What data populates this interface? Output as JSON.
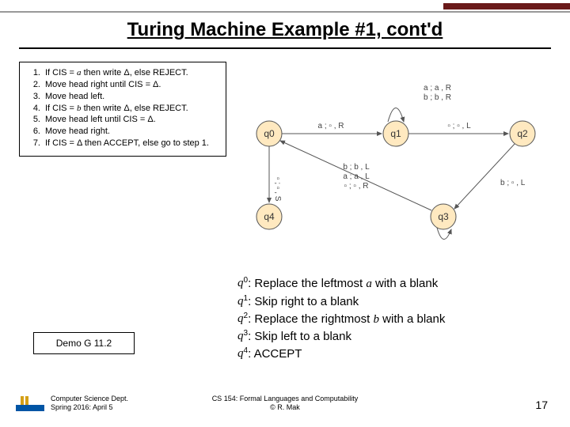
{
  "title": "Turing Machine Example #1, cont'd",
  "algorithm": [
    {
      "n": "1.",
      "txt": "If CIS = <i>a</i> then write Δ, else REJECT."
    },
    {
      "n": "2.",
      "txt": "Move head right until CIS = Δ."
    },
    {
      "n": "3.",
      "txt": "Move head left."
    },
    {
      "n": "4.",
      "txt": "If CIS = <i>b</i> then write Δ, else REJECT."
    },
    {
      "n": "5.",
      "txt": "Move head left until CIS = Δ."
    },
    {
      "n": "6.",
      "txt": "Move head right."
    },
    {
      "n": "7.",
      "txt": "If CIS = Δ then ACCEPT, else go to step 1."
    }
  ],
  "diagram": {
    "nodes": {
      "q0": "q0",
      "q1": "q1",
      "q2": "q2",
      "q3": "q3",
      "q4": "q4"
    },
    "edges": {
      "q0_q1": "a ; ▫ , R",
      "q1_loop_a": "a ; a , R",
      "q1_loop_b": "b ; b , R",
      "q1_q2": "▫ ; ▫ , L",
      "q2_q3": "b ; ▫ , L",
      "q3_loop_a": "a ; a , L",
      "q3_loop_b": "b ; b , L",
      "q3_q0": "▫ ; ▫ , R",
      "q0_q4": "▫ ; ▫ , S"
    }
  },
  "states": [
    {
      "q": "q",
      "sub": "0",
      "desc": ": Replace the leftmost <i>a</i> with a blank"
    },
    {
      "q": "q",
      "sub": "1",
      "desc": ": Skip right to a blank"
    },
    {
      "q": "q",
      "sub": "2",
      "desc": ": Replace the rightmost <i>b</i> with a blank"
    },
    {
      "q": "q",
      "sub": "3",
      "desc": ": Skip left to a blank"
    },
    {
      "q": "q",
      "sub": "4",
      "desc": ": ACCEPT"
    }
  ],
  "demo": "Demo G 11.2",
  "footer": {
    "left1": "Computer Science Dept.",
    "left2": "Spring 2016: April 5",
    "center1": "CS 154: Formal Languages and Computability",
    "center2": "© R. Mak"
  },
  "page": "17"
}
